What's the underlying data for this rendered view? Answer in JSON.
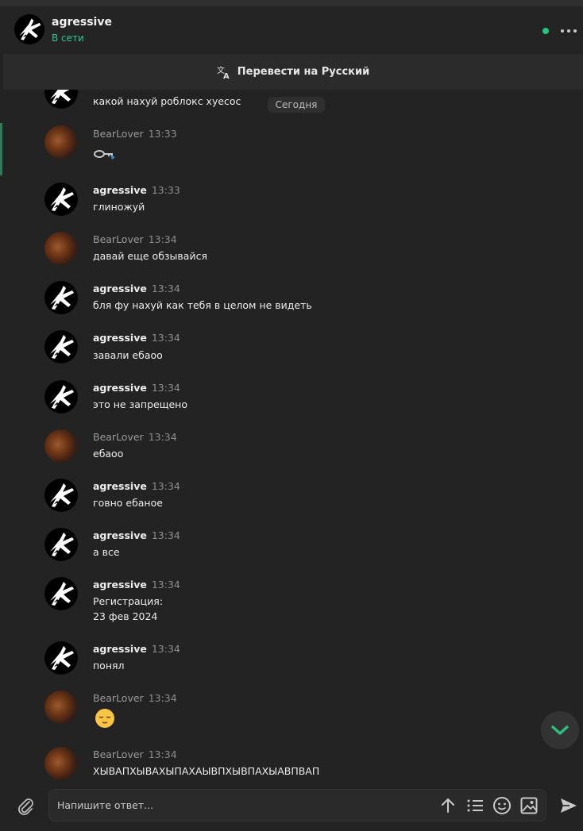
{
  "header": {
    "name": "agressive",
    "status": "В сети"
  },
  "translate_bar": {
    "label": "Перевести на Русский"
  },
  "date_separator": "Сегодня",
  "partial_message": {
    "text": "какой нахуй роблокс хуесос"
  },
  "messages": [
    {
      "author": "BearLover",
      "time": "13:33",
      "text": ""
    },
    {
      "author": "agressive",
      "time": "13:33",
      "text": "глиножуй"
    },
    {
      "author": "BearLover",
      "time": "13:34",
      "text": "давай еще обзывайся"
    },
    {
      "author": "agressive",
      "time": "13:34",
      "text": "бля фу нахуй как тебя в целом не видеть"
    },
    {
      "author": "agressive",
      "time": "13:34",
      "text": "завали ебаоо"
    },
    {
      "author": "agressive",
      "time": "13:34",
      "text": "это не запрещено"
    },
    {
      "author": "BearLover",
      "time": "13:34",
      "text": "ебаоо"
    },
    {
      "author": "agressive",
      "time": "13:34",
      "text": "говно ебаное"
    },
    {
      "author": "agressive",
      "time": "13:34",
      "text": "а все"
    },
    {
      "author": "agressive",
      "time": "13:34",
      "text_line1": "Регистрация:",
      "text_line2": "23 фев 2024"
    },
    {
      "author": "agressive",
      "time": "13:34",
      "text": "понял"
    },
    {
      "author": "BearLover",
      "time": "13:34",
      "text": ""
    },
    {
      "author": "BearLover",
      "time": "13:34",
      "text": "ХЫВАПХЫВАХЫПАХАЫВПХЫВПАХЫАВПВАП"
    }
  ],
  "composer": {
    "placeholder": "Напишите ответ..."
  },
  "icons": {
    "translate": "translate-icon",
    "more": "more-dots-icon",
    "attach": "paperclip-icon",
    "format": "arrow-up-icon",
    "list": "list-icon",
    "emoji": "smiley-icon",
    "image": "image-icon",
    "send": "send-icon",
    "scroll": "chevron-down-icon"
  },
  "colors": {
    "accent_green": "#33c48c",
    "online_dot": "#22c77a",
    "background": "#232323"
  }
}
